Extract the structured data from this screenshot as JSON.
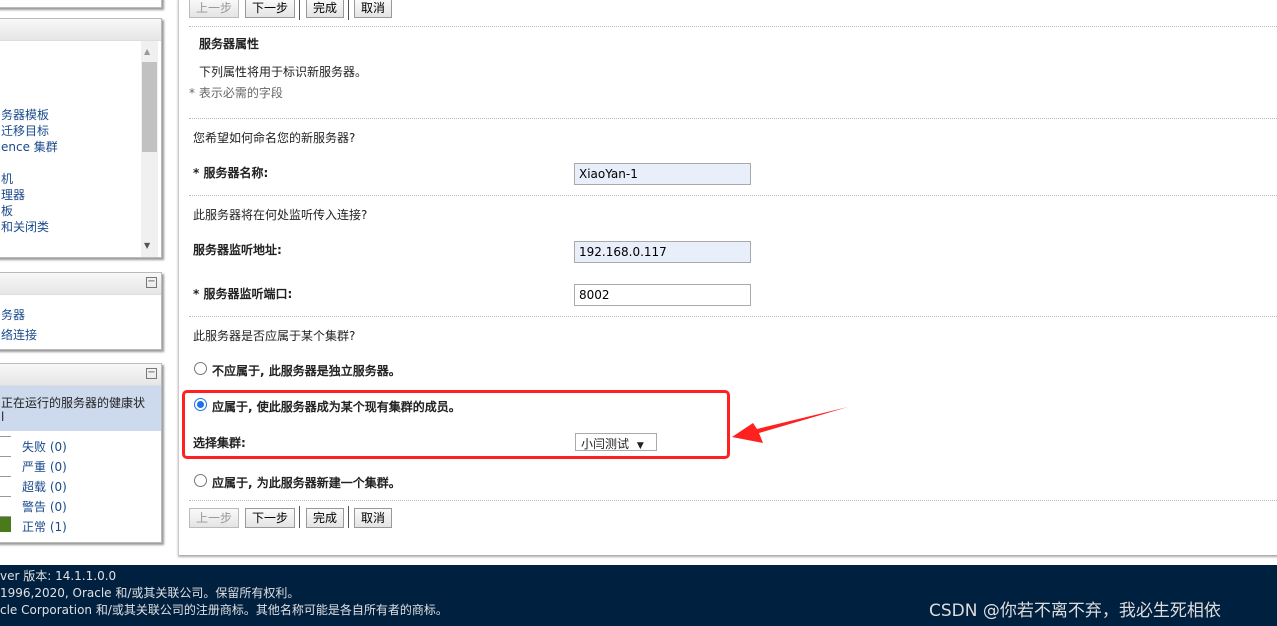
{
  "sidebar": {
    "tree_items": [
      "务器模板",
      "迁移目标",
      "ence 集群",
      "机",
      "理器",
      "板",
      "和关闭类"
    ],
    "panel3_items": [
      "务器",
      "络连接"
    ],
    "health": {
      "title": "正在运行的服务器的健康状",
      "title_line2": "l",
      "rows": [
        {
          "label": "失败 (0)",
          "color": "#ffffff"
        },
        {
          "label": "严重 (0)",
          "color": "#ffffff"
        },
        {
          "label": "超载 (0)",
          "color": "#ffffff"
        },
        {
          "label": "警告 (0)",
          "color": "#ffffff"
        },
        {
          "label": "正常 (1)",
          "color": "#4a7a1c"
        }
      ]
    }
  },
  "buttons": {
    "back": "上一步",
    "next": "下一步",
    "finish": "完成",
    "cancel": "取消"
  },
  "form": {
    "section_title": "服务器属性",
    "description": "下列属性将用于标识新服务器。",
    "required_note": "* 表示必需的字段",
    "q_name": "您希望如何命名您的新服务器?",
    "name_label": "* 服务器名称:",
    "name_value": "XiaoYan-1",
    "q_listen": "此服务器将在何处监听传入连接?",
    "address_label": "服务器监听地址:",
    "address_value": "192.168.0.117",
    "port_label": "* 服务器监听端口:",
    "port_value": "8002",
    "q_cluster": "此服务器是否应属于某个集群?",
    "opt_standalone": "不应属于, 此服务器是独立服务器。",
    "opt_existing": "应属于, 使此服务器成为某个现有集群的成员。",
    "select_cluster_label": "选择集群:",
    "cluster_value": "小闫测试",
    "opt_new": "应属于, 为此服务器新建一个集群。",
    "selected_option": "existing"
  },
  "footer": {
    "version": "ver 版本: 14.1.1.0.0",
    "copyright": "1996,2020, Oracle 和/或其关联公司。保留所有权利。",
    "trademark": "cle Corporation 和/或其关联公司的注册商标。其他名称可能是各自所有者的商标。",
    "watermark": "CSDN @你若不离不弃，我必生死相依"
  },
  "annotation_color": "#ff2020"
}
